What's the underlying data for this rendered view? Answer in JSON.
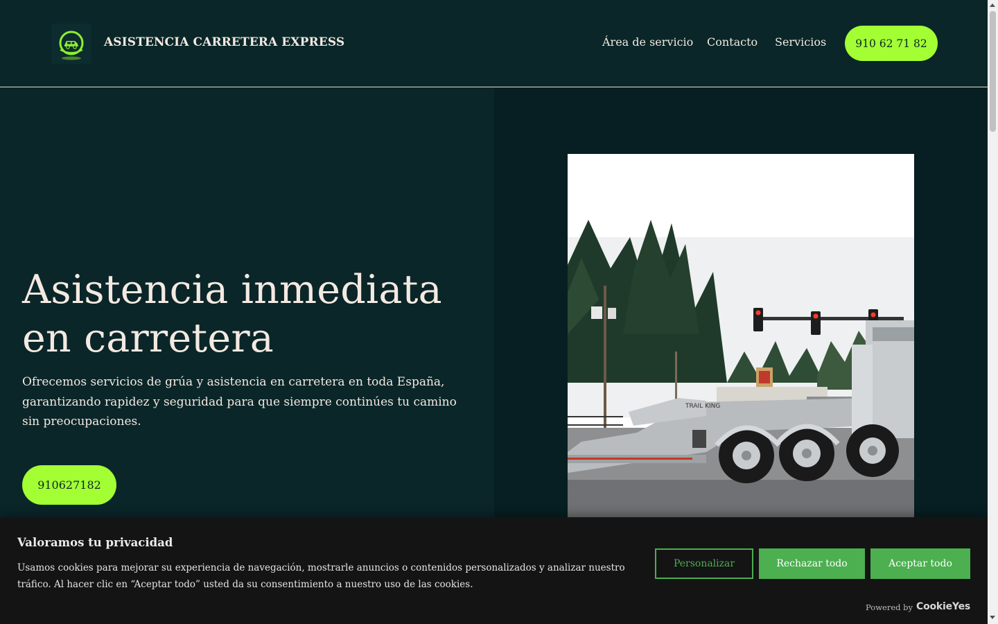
{
  "header": {
    "brand": "ASISTENCIA CARRETERA EXPRESS",
    "nav": [
      "Área de servicio",
      "Contacto",
      "Servicios"
    ],
    "phone_button": "910 62 71 82"
  },
  "hero": {
    "title": "Asistencia inmediata en carretera",
    "text": "Ofrecemos servicios de grúa y asistencia en carretera en toda España, garantizando rapidez y seguridad para que siempre continúes tu camino sin preocupaciones.",
    "button": "910627182",
    "truck_label": "TRAIL KING"
  },
  "cookie": {
    "title": "Valoramos tu privacidad",
    "text": "Usamos cookies para mejorar su experiencia de navegación, mostrarle anuncios o contenidos personalizados y analizar nuestro tráfico. Al hacer clic en “Aceptar todo” usted da su consentimiento a nuestro uso de las cookies.",
    "customize": "Personalizar",
    "reject": "Rechazar todo",
    "accept": "Aceptar todo",
    "powered_by": "Powered by",
    "powered_brand": "CookieYes"
  },
  "colors": {
    "background": "#0a2629",
    "accent": "#a3ff33",
    "cookie_green": "#4caf50",
    "text": "#f4e9e1"
  },
  "icons": {
    "logo": "tow-truck-logo-icon"
  }
}
